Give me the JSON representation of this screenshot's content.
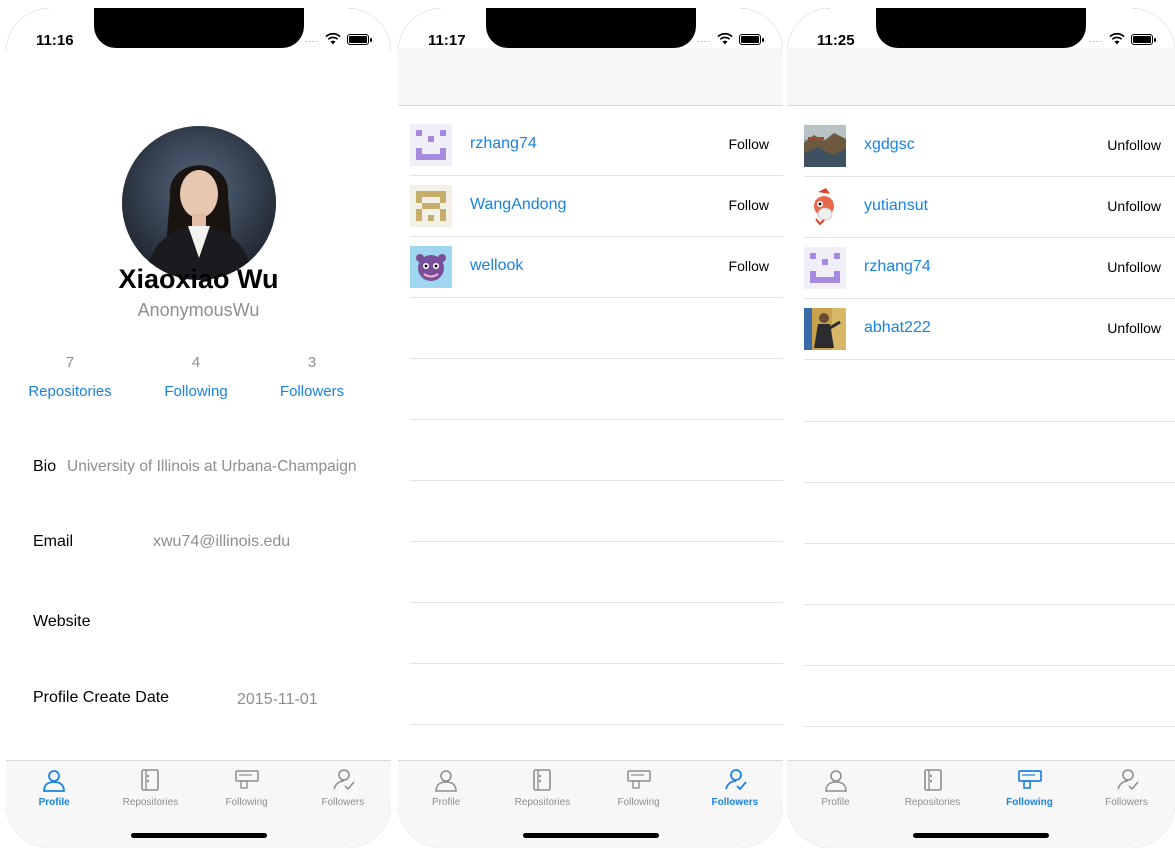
{
  "phones": [
    {
      "time": "11:16",
      "profile": {
        "name": "Xiaoxiao Wu",
        "login": "AnonymousWu",
        "stats": [
          {
            "count": "7",
            "label": "Repositories"
          },
          {
            "count": "4",
            "label": "Following"
          },
          {
            "count": "3",
            "label": "Followers"
          }
        ],
        "bio_label": "Bio",
        "bio_value": "University of Illinois at Urbana-Champaign",
        "email_label": "Email",
        "email_value": "xwu74@illinois.edu",
        "website_label": "Website",
        "website_value": "",
        "create_label": "Profile Create Date",
        "create_value": "2015-11-01"
      },
      "active_tab": "Profile"
    },
    {
      "time": "11:17",
      "rows": [
        {
          "username": "rzhang74",
          "action": "Follow",
          "avatar": "purple-pixel-avatar"
        },
        {
          "username": "WangAndong",
          "action": "Follow",
          "avatar": "tan-pixel-avatar"
        },
        {
          "username": "wellook",
          "action": "Follow",
          "avatar": "purple-creature-avatar"
        }
      ],
      "active_tab": "Followers"
    },
    {
      "time": "11:25",
      "rows": [
        {
          "username": "xgdgsc",
          "action": "Unfollow",
          "avatar": "landscape-photo-avatar"
        },
        {
          "username": "yutiansut",
          "action": "Unfollow",
          "avatar": "red-character-avatar"
        },
        {
          "username": "rzhang74",
          "action": "Unfollow",
          "avatar": "purple-pixel-avatar"
        },
        {
          "username": "abhat222",
          "action": "Unfollow",
          "avatar": "person-photo-avatar"
        }
      ],
      "active_tab": "Following"
    }
  ],
  "tabs": [
    {
      "label": "Profile",
      "icon": "person-icon"
    },
    {
      "label": "Repositories",
      "icon": "repository-icon"
    },
    {
      "label": "Following",
      "icon": "following-icon"
    },
    {
      "label": "Followers",
      "icon": "followers-icon"
    }
  ],
  "colors": {
    "accent": "#1a82e2",
    "secondary_text": "#8e8e93"
  }
}
